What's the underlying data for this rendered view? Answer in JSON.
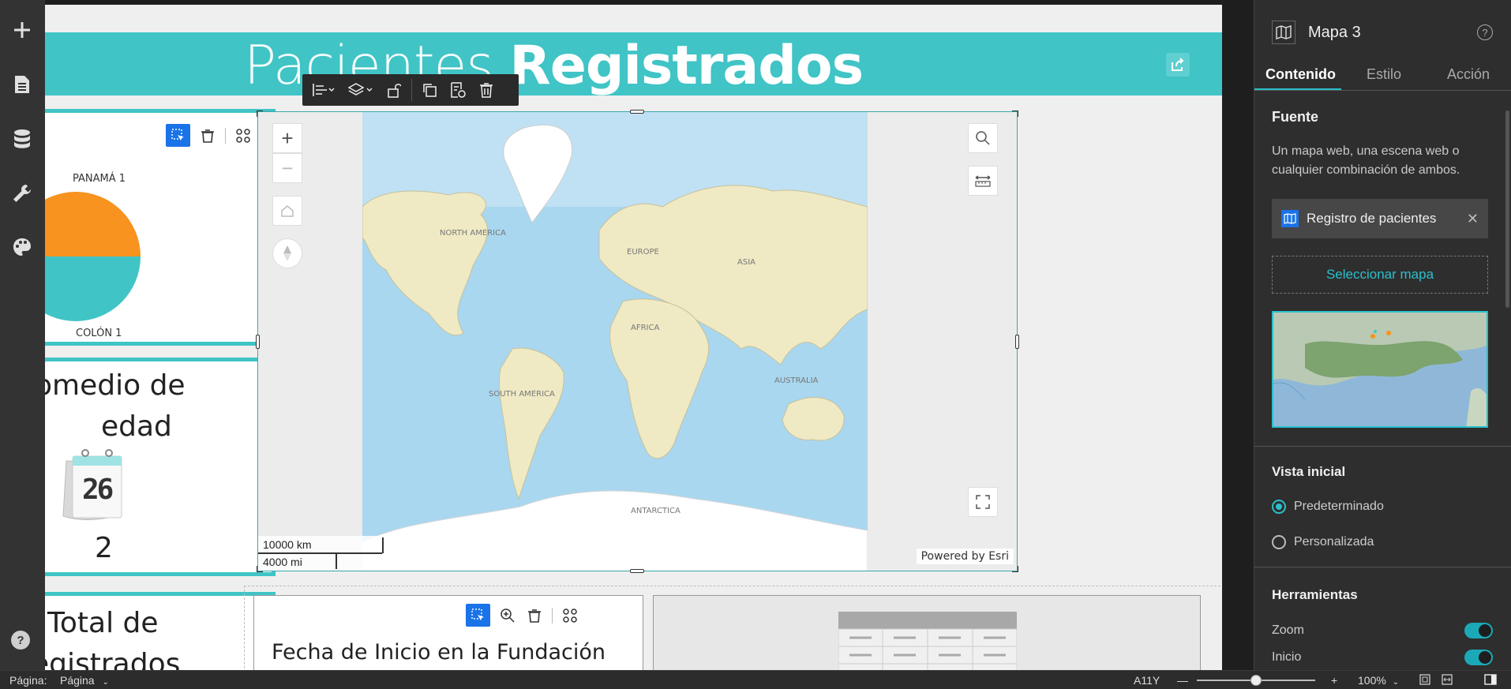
{
  "left_toolbar": {
    "items": [
      {
        "name": "add-icon"
      },
      {
        "name": "page-icon"
      },
      {
        "name": "data-icon"
      },
      {
        "name": "wrench-icon"
      },
      {
        "name": "palette-icon"
      }
    ],
    "help": "?"
  },
  "header": {
    "title_light": "Pacientes ",
    "title_bold": "Registrados"
  },
  "pie_card": {
    "label_top": "PANAMÁ 1",
    "label_bottom": "COLÓN 1",
    "colors": {
      "top": "#f7931e",
      "bottom": "#40c4c6"
    }
  },
  "age_card": {
    "line1": "omedio de",
    "line2": "edad",
    "calendar_number": "26",
    "value": "2"
  },
  "total_card": {
    "line1": "Total de",
    "line2": "egistrados"
  },
  "fecha_card": {
    "title": "Fecha de Inicio en la Fundación"
  },
  "map": {
    "labels": {
      "north_america": "NORTH AMERICA",
      "south_america": "SOUTH AMERICA",
      "europe": "EUROPE",
      "africa": "AFRICA",
      "asia": "ASIA",
      "australia": "AUSTRALIA",
      "antarctica": "ANTARCTICA"
    },
    "scale_km": "10000 km",
    "scale_mi": "4000 mi",
    "attribution": "Powered by Esri"
  },
  "right_panel": {
    "title": "Mapa 3",
    "tabs": [
      "Contenido",
      "Estilo",
      "Acción"
    ],
    "fuente_title": "Fuente",
    "fuente_desc": "Un mapa web, una escena web o cualquier combinación de ambos.",
    "source_name": "Registro de pacientes",
    "select_map": "Seleccionar mapa",
    "vista_title": "Vista inicial",
    "vista_options": [
      "Predeterminado",
      "Personalizada"
    ],
    "tools_title": "Herramientas",
    "tools": [
      "Zoom",
      "Inicio"
    ]
  },
  "status_bar": {
    "page_label": "Página:",
    "page_value": "Página",
    "device": "A11Y",
    "zoom_level": "100%",
    "zoom_fraction": 0.5
  },
  "colors": {
    "accent": "#40c4c6",
    "selection_blue": "#1a73e8",
    "panel_accent": "#29c0cc"
  }
}
